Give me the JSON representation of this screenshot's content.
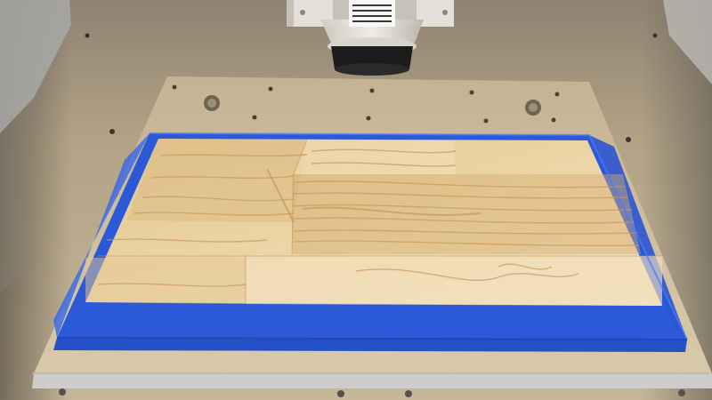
{
  "scene": {
    "subject": "cnc-router-workpiece",
    "colors": {
      "background_panel": "#b7a78a",
      "spoilboard": "#d1c2a3",
      "spoilboard_edge": "#cfcfcd",
      "wood_light": "#ead3a3",
      "wood_mid": "#dbb57e",
      "wood_grain": "#c79a5f",
      "masking_tape": "#2f5fe0",
      "spindle_dark": "#1c1c1c",
      "spindle_clear": "#dad6cf"
    },
    "icons": [
      "spindle-icon",
      "workpiece",
      "spoilboard",
      "mounting-hole"
    ]
  }
}
